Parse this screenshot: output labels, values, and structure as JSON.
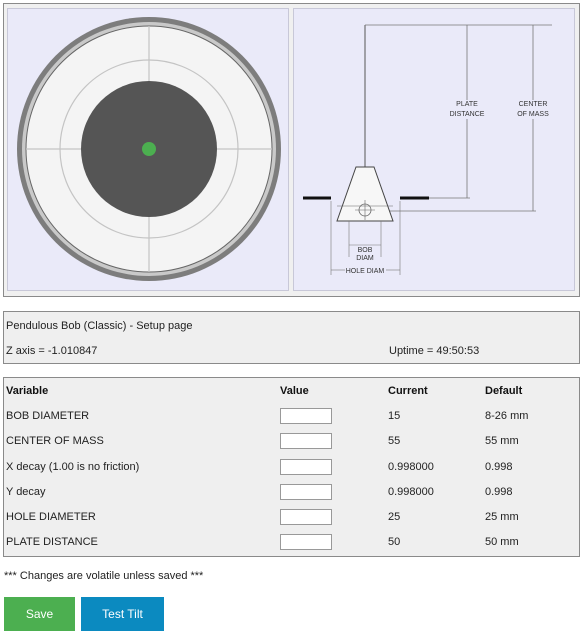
{
  "diagram": {
    "plate_distance_label": [
      "PLATE",
      "DISTANCE"
    ],
    "center_of_mass_label": [
      "CENTER",
      "OF MASS"
    ],
    "bob_diam_label": [
      "BOB",
      "DIAM"
    ],
    "hole_diam_label": "HOLE DIAM",
    "colors": {
      "bob": "#555555",
      "marker": "#4caf50",
      "ring": "#7a7a7a"
    }
  },
  "info": {
    "title": "Pendulous Bob (Classic) - Setup page",
    "z_axis": "Z axis = -1.010847",
    "uptime": "Uptime = 49:50:53"
  },
  "table": {
    "headers": {
      "variable": "Variable",
      "value": "Value",
      "current": "Current",
      "default": "Default"
    },
    "rows": [
      {
        "variable": "BOB DIAMETER",
        "value": "",
        "current": "15",
        "default": "8-26 mm"
      },
      {
        "variable": "CENTER OF MASS",
        "value": "",
        "current": "55",
        "default": "55 mm"
      },
      {
        "variable": "X decay (1.00 is no friction)",
        "value": "",
        "current": "0.998000",
        "default": "0.998"
      },
      {
        "variable": "Y decay",
        "value": "",
        "current": "0.998000",
        "default": "0.998"
      },
      {
        "variable": "HOLE DIAMETER",
        "value": "",
        "current": "25",
        "default": "25 mm"
      },
      {
        "variable": "PLATE DISTANCE",
        "value": "",
        "current": "50",
        "default": "50 mm"
      }
    ]
  },
  "note": "*** Changes are volatile unless saved ***",
  "buttons": {
    "save": "Save",
    "test_tilt": "Test Tilt"
  }
}
